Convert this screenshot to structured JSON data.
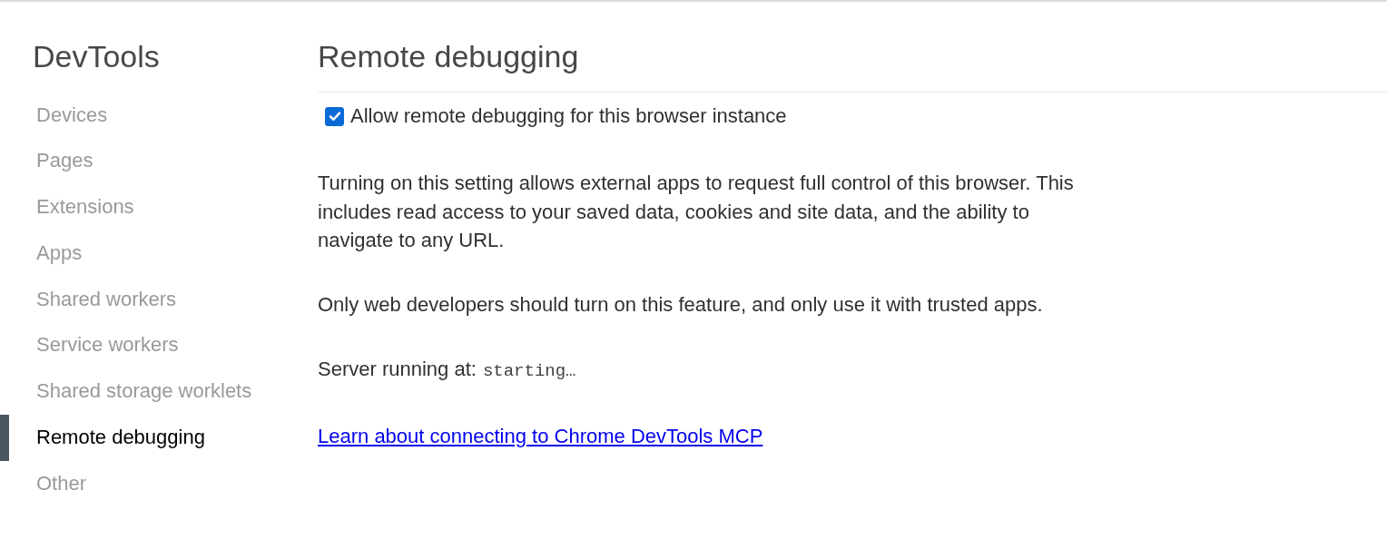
{
  "sidebar": {
    "title": "DevTools",
    "items": [
      {
        "label": "Devices",
        "selected": false
      },
      {
        "label": "Pages",
        "selected": false
      },
      {
        "label": "Extensions",
        "selected": false
      },
      {
        "label": "Apps",
        "selected": false
      },
      {
        "label": "Shared workers",
        "selected": false
      },
      {
        "label": "Service workers",
        "selected": false
      },
      {
        "label": "Shared storage worklets",
        "selected": false
      },
      {
        "label": "Remote debugging",
        "selected": true
      },
      {
        "label": "Other",
        "selected": false
      }
    ]
  },
  "content": {
    "title": "Remote debugging",
    "checkbox": {
      "label": "Allow remote debugging for this browser instance",
      "checked": true
    },
    "paragraphs": [
      "Turning on this setting allows external apps to request full control of this browser. This includes read access to your saved data, cookies and site data, and the ability to navigate to any URL.",
      "Only web developers should turn on this feature, and only use it with trusted apps."
    ],
    "server_status": {
      "label": "Server running at:",
      "value": "starting…"
    },
    "link": {
      "label": "Learn about connecting to Chrome DevTools MCP"
    }
  }
}
